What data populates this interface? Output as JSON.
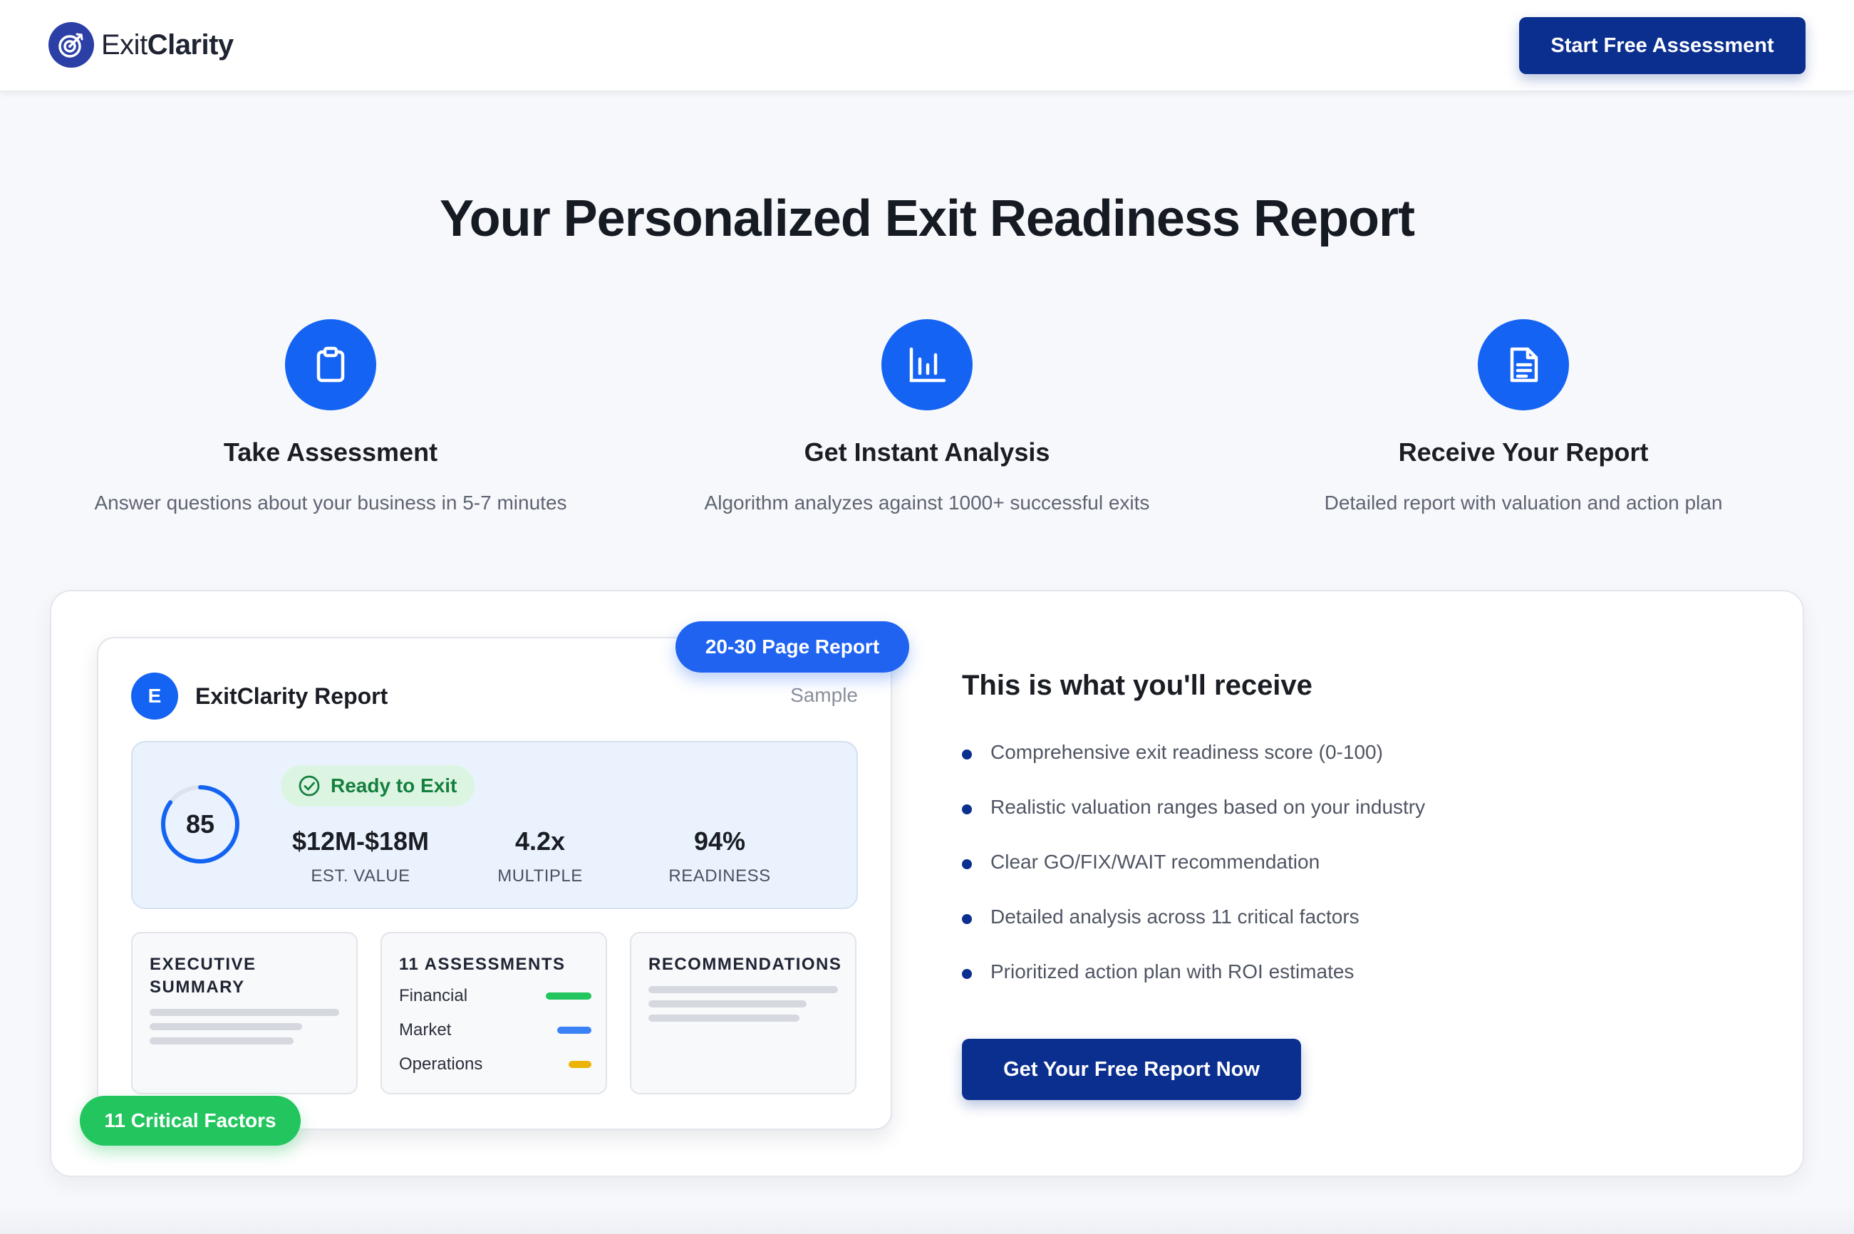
{
  "brand": {
    "name_light": "Exit",
    "name_bold": "Clarity",
    "logo_icon": "target-arrow-icon"
  },
  "header": {
    "cta_label": "Start Free Assessment"
  },
  "hero": {
    "title": "Your Personalized Exit Readiness Report"
  },
  "steps": [
    {
      "icon": "clipboard-icon",
      "title": "Take Assessment",
      "desc": "Answer questions about your business in 5-7 minutes"
    },
    {
      "icon": "bar-chart-icon",
      "title": "Get Instant Analysis",
      "desc": "Algorithm analyzes against 1000+ successful exits"
    },
    {
      "icon": "document-icon",
      "title": "Receive Your Report",
      "desc": "Detailed report with valuation and action plan"
    }
  ],
  "report": {
    "badge_pages": "20-30 Page Report",
    "badge_factors": "11 Critical Factors",
    "avatar_letter": "E",
    "title": "ExitClarity Report",
    "sample_label": "Sample",
    "score": "85",
    "score_fraction": 0.85,
    "status": "Ready to Exit",
    "metrics": [
      {
        "value": "$12M-$18M",
        "label": "EST. VALUE"
      },
      {
        "value": "4.2x",
        "label": "MULTIPLE"
      },
      {
        "value": "94%",
        "label": "READINESS"
      }
    ],
    "cards": {
      "summary_title_1": "EXECUTIVE",
      "summary_title_2": "SUMMARY",
      "assessments_title": "11 ASSESSMENTS",
      "factors": [
        {
          "name": "Financial",
          "color": "#22c55e",
          "level": 1.0
        },
        {
          "name": "Market",
          "color": "#3b82f6",
          "level": 0.75
        },
        {
          "name": "Operations",
          "color": "#eab308",
          "level": 0.5
        }
      ],
      "recommendations_title": "RECOMMENDATIONS"
    }
  },
  "receive": {
    "title": "This is what you'll receive",
    "items": [
      "Comprehensive exit readiness score (0-100)",
      "Realistic valuation ranges based on your industry",
      "Clear GO/FIX/WAIT recommendation",
      "Detailed analysis across 11 critical factors",
      "Prioritized action plan with ROI estimates"
    ],
    "cta_label": "Get Your Free Report Now"
  },
  "colors": {
    "primary_dark": "#0b2f8f",
    "primary": "#1463f3",
    "success": "#22c55e"
  }
}
